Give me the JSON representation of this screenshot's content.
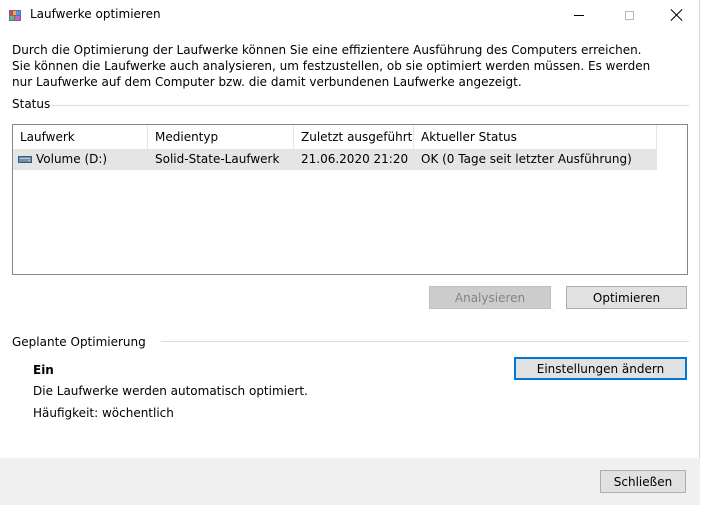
{
  "window": {
    "title": "Laufwerke optimieren",
    "icon": "defrag-app-icon"
  },
  "description": "Durch die Optimierung der Laufwerke können Sie eine effizientere Ausführung des Computers erreichen. Sie können die Laufwerke auch analysieren, um festzustellen, ob sie optimiert werden müssen. Es werden nur Laufwerke auf dem Computer bzw. die damit verbundenen Laufwerke angezeigt.",
  "status": {
    "label": "Status",
    "columns": [
      "Laufwerk",
      "Medientyp",
      "Zuletzt ausgeführt",
      "Aktueller Status"
    ],
    "rows": [
      {
        "drive": "Volume (D:)",
        "media_type": "Solid-State-Laufwerk",
        "last_run": "21.06.2020 21:20",
        "current_status": "OK (0 Tage seit letzter Ausführung)",
        "icon": "drive-icon"
      }
    ]
  },
  "buttons": {
    "analyze": "Analysieren",
    "optimize": "Optimieren",
    "change_settings": "Einstellungen ändern",
    "close": "Schließen"
  },
  "scheduled": {
    "label": "Geplante Optimierung",
    "state": "Ein",
    "info": "Die Laufwerke werden automatisch optimiert.",
    "frequency": "Häufigkeit: wöchentlich"
  }
}
